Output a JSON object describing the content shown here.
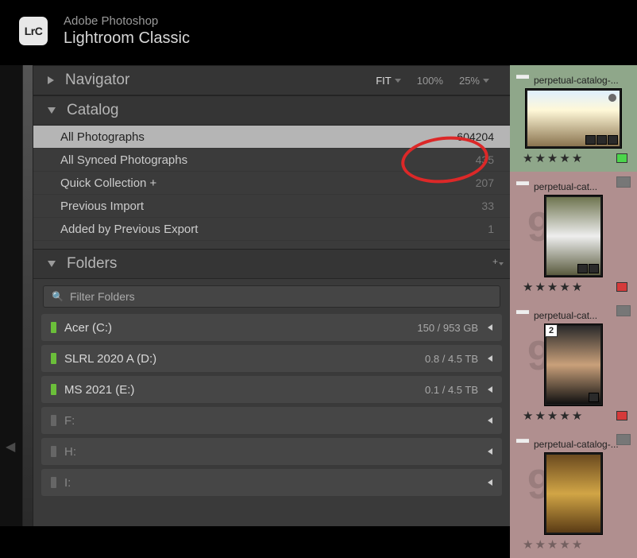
{
  "app": {
    "suite": "Adobe Photoshop",
    "name": "Lightroom Classic",
    "logo_text": "LrC"
  },
  "navigator": {
    "title": "Navigator",
    "zoom_fit": "FIT",
    "zoom_100": "100%",
    "zoom_25": "25%"
  },
  "catalog": {
    "title": "Catalog",
    "rows": [
      {
        "label": "All Photographs",
        "count": "604204",
        "selected": true
      },
      {
        "label": "All Synced Photographs",
        "count": "435",
        "selected": false
      },
      {
        "label": "Quick Collection  +",
        "count": "207",
        "selected": false
      },
      {
        "label": "Previous Import",
        "count": "33",
        "selected": false
      },
      {
        "label": "Added by Previous Export",
        "count": "1",
        "selected": false
      }
    ]
  },
  "folders": {
    "title": "Folders",
    "filter_placeholder": "Filter Folders",
    "volumes": [
      {
        "name": "Acer (C:)",
        "size": "150 / 953 GB",
        "online": true
      },
      {
        "name": "SLRL 2020 A (D:)",
        "size": "0.8 / 4.5 TB",
        "online": true
      },
      {
        "name": "MS 2021 (E:)",
        "size": "0.1 / 4.5 TB",
        "online": true
      },
      {
        "name": "F:",
        "size": "",
        "online": false
      },
      {
        "name": "H:",
        "size": "",
        "online": false
      },
      {
        "name": "I:",
        "size": "",
        "online": false
      }
    ]
  },
  "filmstrip": {
    "thumbs": [
      {
        "name": "perpetual-catalog-...",
        "orientation": "landscape",
        "stars": 5,
        "color": "green",
        "stack": null,
        "tone": "green",
        "img": "sky",
        "badges": 3
      },
      {
        "name": "perpetual-cat...",
        "orientation": "portrait",
        "stars": 5,
        "color": "red",
        "stack": null,
        "tone": "rose",
        "img": "forest",
        "badges": 2
      },
      {
        "name": "perpetual-cat...",
        "orientation": "portrait",
        "stars": 5,
        "color": "red",
        "stack": "2",
        "tone": "rose",
        "img": "dark",
        "badges": 1
      },
      {
        "name": "perpetual-catalog-...",
        "orientation": "portrait",
        "stars": 0,
        "color": null,
        "stack": null,
        "tone": "rose",
        "img": "gold",
        "badges": 0
      }
    ]
  }
}
